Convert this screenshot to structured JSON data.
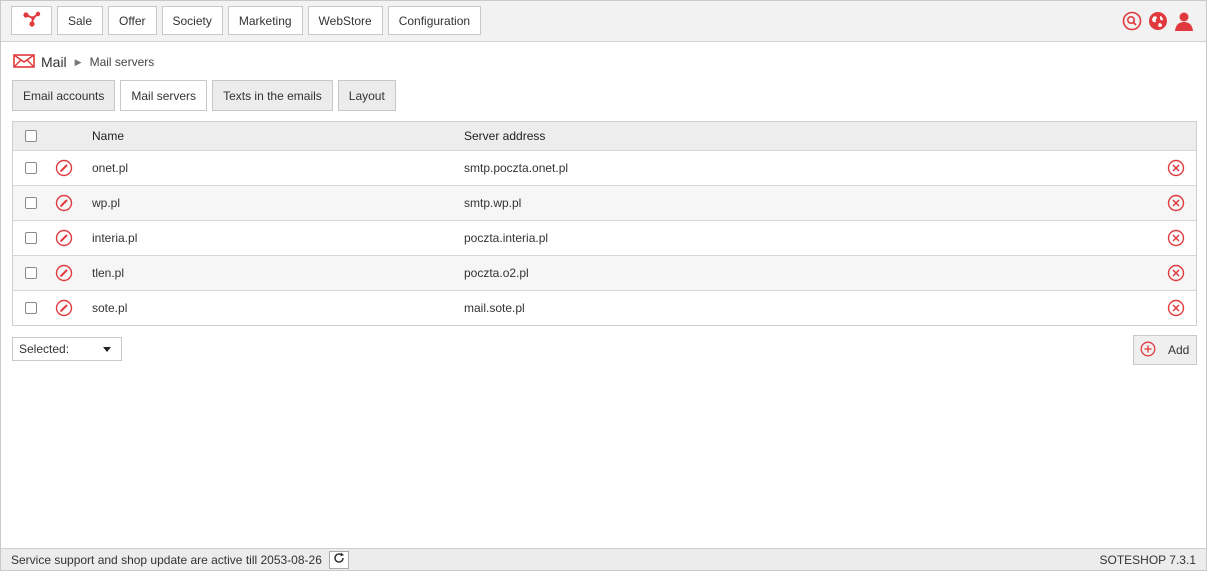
{
  "colors": {
    "accent": "#e03a3e",
    "border": "#c8c8c8"
  },
  "topnav": {
    "logo_icon": "soteshop-logo-icon",
    "items": [
      {
        "label": "Sale"
      },
      {
        "label": "Offer"
      },
      {
        "label": "Society"
      },
      {
        "label": "Marketing"
      },
      {
        "label": "WebStore"
      },
      {
        "label": "Configuration"
      }
    ],
    "icons": [
      "search-icon",
      "globe-icon",
      "user-icon"
    ]
  },
  "breadcrumb": {
    "icon": "mail-envelope-icon",
    "root": "Mail",
    "current": "Mail servers"
  },
  "tabs": [
    {
      "label": "Email accounts",
      "active": false
    },
    {
      "label": "Mail servers",
      "active": true
    },
    {
      "label": "Texts in the emails",
      "active": false
    },
    {
      "label": "Layout",
      "active": false
    }
  ],
  "table": {
    "headers": {
      "name": "Name",
      "address": "Server address"
    },
    "rows": [
      {
        "name": "onet.pl",
        "address": "smtp.poczta.onet.pl"
      },
      {
        "name": "wp.pl",
        "address": "smtp.wp.pl"
      },
      {
        "name": "interia.pl",
        "address": "poczta.interia.pl"
      },
      {
        "name": "tlen.pl",
        "address": "poczta.o2.pl"
      },
      {
        "name": "sote.pl",
        "address": "mail.sote.pl"
      }
    ]
  },
  "actions": {
    "selected_label": "Selected:",
    "add_label": "Add"
  },
  "footer": {
    "status": "Service support and shop update are active till 2053-08-26",
    "version": "SOTESHOP 7.3.1"
  }
}
